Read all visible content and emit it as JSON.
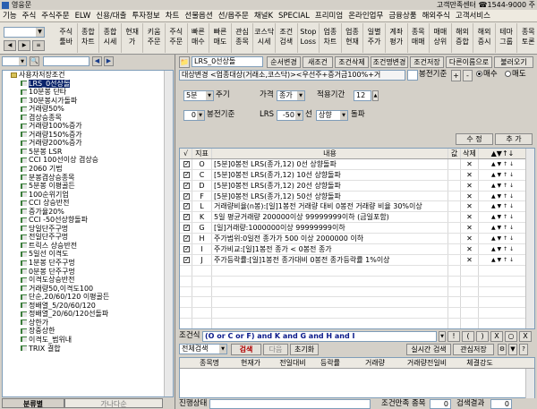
{
  "window": {
    "title": "영웅문",
    "right_text": "고객만족센터 ☎1544-9000 주"
  },
  "menu": [
    "기능",
    "주식",
    "주식주문",
    "ELW",
    "신용/대출",
    "투자정보",
    "차트",
    "선물옵션",
    "선/옵주문",
    "채널K",
    "SPECIAL",
    "프리미엄",
    "온라인업무",
    "금융상품",
    "해외주식",
    "고객서비스"
  ],
  "toolbar": {
    "combo_value": "",
    "buttons": [
      {
        "top": "주식",
        "bottom": "툴바"
      },
      {
        "top": "종합",
        "bottom": "차트"
      },
      {
        "top": "종합",
        "bottom": "시세"
      },
      {
        "top": "현재",
        "bottom": "가"
      },
      {
        "top": "키움",
        "bottom": "주문"
      },
      {
        "top": "주식",
        "bottom": "주문"
      },
      {
        "top": "빠른",
        "bottom": "매수"
      },
      {
        "top": "빠른",
        "bottom": "매도"
      },
      {
        "top": "관심",
        "bottom": "종목"
      },
      {
        "top": "코스닥",
        "bottom": "시세"
      },
      {
        "top": "조건",
        "bottom": "검색"
      },
      {
        "top": "Stop",
        "bottom": "Loss"
      },
      {
        "top": "업종",
        "bottom": "차트"
      },
      {
        "top": "업종",
        "bottom": "현재"
      },
      {
        "top": "일별",
        "bottom": "주가"
      },
      {
        "top": "계좌",
        "bottom": "평가"
      },
      {
        "top": "종목",
        "bottom": "매매"
      },
      {
        "top": "매매",
        "bottom": "상위"
      },
      {
        "top": "해외",
        "bottom": "증합"
      },
      {
        "top": "해외",
        "bottom": "증시"
      },
      {
        "top": "테마",
        "bottom": "그룹"
      },
      {
        "top": "종목",
        "bottom": "토론"
      }
    ]
  },
  "left": {
    "tree_root": "사용자저장조건",
    "items": [
      "LRS_0선상돌",
      "10분봉 단타",
      "30분봉시가돌파",
      "거래량50%",
      "겹상승종목",
      "거래량100%증가",
      "거래량150%증가",
      "거래량200%증가",
      "5분봉 LSR",
      "CCI 100선이상 겹상승",
      "2060 기법",
      "분봉겹상승종목",
      "5분봉 이평골든",
      "100순위기업",
      "CCI 상승반전",
      "증가율20%",
      "CCI -50선상향돌파",
      "당일단주구멍",
      "전일단주구멍",
      "트릭스 상승반전",
      "5일선 이격도",
      "1분봉 단주구멍",
      "0분봉 단주구멍",
      "이격도상승반전",
      "거래량50,이격도100",
      "단순,20/60/120 이평골든",
      "정배열_5/20/60/120",
      "정배열_20/60/120선돌파",
      "상한가",
      "장중상한",
      "이격도_범위내",
      "TRIX 결합"
    ],
    "tab_left": "분류별",
    "tab_right": "가나다순"
  },
  "right": {
    "cond_name": "LRS_0선상돌",
    "top_buttons": [
      "순서변경",
      "새조건",
      "조건삭제",
      "조건명변경",
      "조건저장",
      "다른이름으로",
      "불러오기"
    ],
    "target_text": "대상변경 <업종대상(거래소,코스닥)><우선주+증거금100%+거",
    "cmp_label": "봉전기준",
    "plus": "+",
    "minus": "-",
    "buy_label": "매수",
    "sell_label": "매도",
    "period_value": "5분",
    "period_label": "주기",
    "price_label": "가격",
    "price_value": "종가",
    "apply_label": "적용기간",
    "apply_value": "12",
    "bong_value": "0",
    "bong_label": "봉전기준",
    "lrs_label": "LRS",
    "lrs_value": "-50",
    "line_label": "선",
    "dir_value": "상향",
    "break_label": "돌파",
    "edit_btn": "수 정",
    "add_btn": "추 가",
    "grid_headers": [
      "√",
      "지표",
      "내용",
      "값",
      "삭제",
      "▲▼↑↓"
    ],
    "rows": [
      {
        "id": "O",
        "text": "[5분]0봉전 LRS(종가,12) 0선 상향돌파",
        "chk": true
      },
      {
        "id": "C",
        "text": "[5분]0봉전 LRS(종가,12) 10선 상향돌파",
        "chk": true
      },
      {
        "id": "D",
        "text": "[5분]0봉전 LRS(종가,12) 20선 상향돌파",
        "chk": true
      },
      {
        "id": "F",
        "text": "[5분]0봉전 LRS(종가,12) 50선 상향돌파",
        "chk": true
      },
      {
        "id": "L",
        "text": "거래량비율(n봉):[일]1봉전 거래량 대비 0봉전 거래량 비율 30%이상",
        "chk": true
      },
      {
        "id": "K",
        "text": "5일 평균거래량 200000이상 99999999이하 (금일포함)",
        "chk": true
      },
      {
        "id": "G",
        "text": "[일]거래량:1000000이상 99999999이하",
        "chk": true
      },
      {
        "id": "H",
        "text": "주가범위:0일전 종가가 500 이상 2000000 이하",
        "chk": true
      },
      {
        "id": "I",
        "text": "주가비교:[일]1봉전 종가 < 0봉전 종가",
        "chk": true
      },
      {
        "id": "J",
        "text": "주가등락률:[일]1봉전 종가대비 0봉전 종가등락률 1%이상",
        "chk": true
      },
      {
        "id": "",
        "text": "",
        "chk": false
      },
      {
        "id": "",
        "text": "",
        "chk": false
      },
      {
        "id": "",
        "text": "",
        "chk": false
      },
      {
        "id": "",
        "text": "",
        "chk": false
      },
      {
        "id": "",
        "text": "",
        "chk": false
      },
      {
        "id": "",
        "text": "",
        "chk": false
      }
    ],
    "formula_label": "조건식",
    "formula": "(O or C or F) and K and G and H and I",
    "formula_ops": [
      "!",
      "(",
      ")",
      "X",
      "○",
      "X"
    ],
    "search_scope": "전체검색",
    "search_btn": "검색",
    "next_btn": "다음",
    "reset_btn": "초기화",
    "realtime_btn": "실시간 검색",
    "fav_btn": "관심저장",
    "result_headers": [
      "종목명",
      "현재가",
      "전일대비",
      "등락률",
      "거래량",
      "거래량전일비",
      "체결강도"
    ],
    "status_label": "진행상태",
    "cond_count_label": "조건만족 종목",
    "cond_count_value": "0",
    "search_result_label": "검색결과",
    "search_result_value": "0"
  }
}
